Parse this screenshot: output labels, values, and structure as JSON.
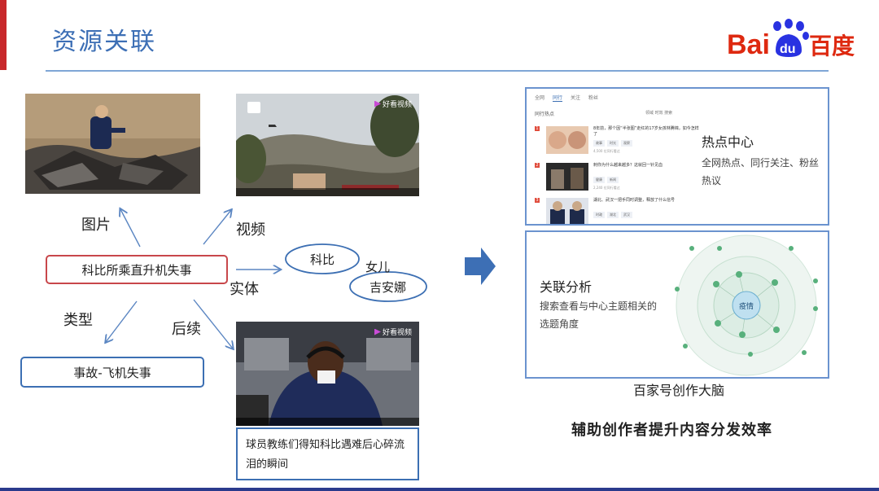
{
  "slide": {
    "title": "资源关联",
    "logo_left": "Bai",
    "logo_paw": "du",
    "logo_right": "百度"
  },
  "graph": {
    "main_node": "科比所乘直升机失事",
    "type_node": "事故-飞机失事",
    "edge_labels": {
      "image": "图片",
      "video": "视频",
      "entity": "实体",
      "type": "类型",
      "followup": "后续"
    },
    "entity": {
      "name": "科比",
      "relation": "女儿",
      "related": "吉安娜"
    }
  },
  "media": {
    "video_badge": "好看视频",
    "video_caption": "球员教练们得知科比遇难后心碎流泪的瞬间"
  },
  "hot_panel": {
    "tabs": [
      "全网",
      "同行",
      "关注",
      "粉丝"
    ],
    "active_tab": 1,
    "subheading": "同行热点",
    "filter": "领域  时效  搜索",
    "items": [
      {
        "num": "1",
        "headline": "8年前，那个因“半张图”走红的17岁女孩林腾锦，如今怎样了",
        "tags": [
          "故事",
          "时光",
          "观察"
        ],
        "meta": "4,500 位同行看过"
      },
      {
        "num": "2",
        "headline": "刺你为什么越来越多？这就回一针见血",
        "tags": [
          "健康",
          "新闻"
        ],
        "meta": "2,240 位同行看过"
      },
      {
        "num": "3",
        "headline": "湖北、武汉一把手同时调整，释放了什么信号",
        "tags": [
          "时政",
          "湖北",
          "武汉"
        ],
        "meta": "1,896 位同行看过"
      }
    ],
    "title": "热点中心",
    "desc": "全网热点、同行关注、粉丝热议"
  },
  "relation_panel": {
    "title": "关联分析",
    "desc": "搜索查看与中心主题相关的选题角度",
    "center_topic": "疫情"
  },
  "product_name": "百家号创作大脑",
  "tagline": "辅助创作者提升内容分发效率",
  "colors": {
    "title_blue": "#3d6fb5",
    "accent_red": "#c8282b",
    "box_blue": "#3c6fb3",
    "main_node_border": "#c8474b",
    "baidu_red": "#de2910",
    "baidu_blue": "#2932e1"
  }
}
